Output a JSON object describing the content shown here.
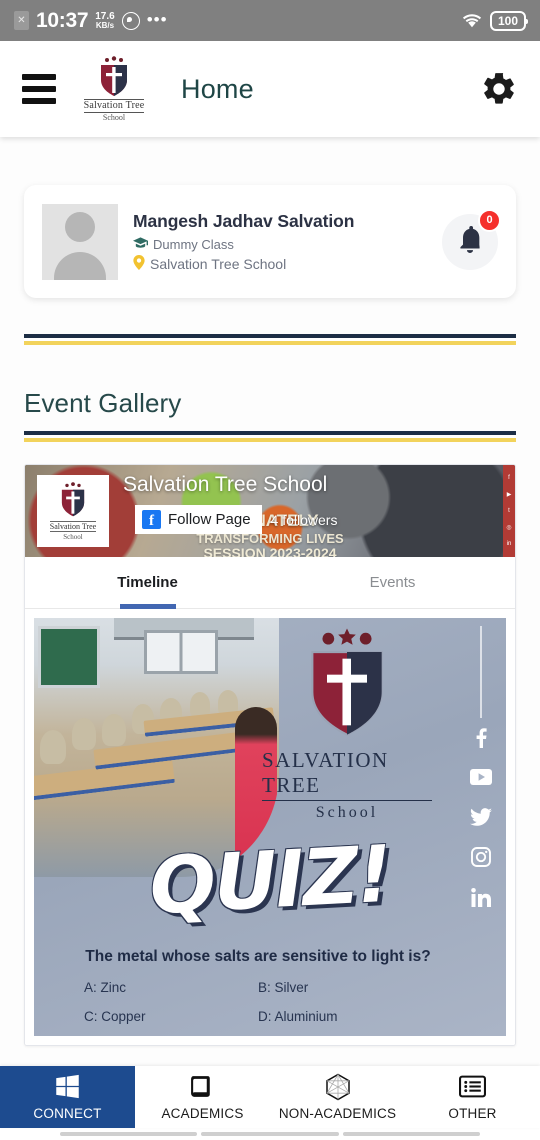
{
  "status_bar": {
    "sim_icon": "sim-card-icon",
    "time": "10:37",
    "net_speed_value": "17.6",
    "net_speed_unit": "KB/s",
    "whatsapp_icon": "whatsapp-icon",
    "more_icon": "more-dots-icon",
    "wifi_icon": "wifi-icon",
    "battery": "100"
  },
  "app_bar": {
    "menu_icon": "hamburger-menu-icon",
    "logo_name": "Salvation Tree",
    "logo_sub": "School",
    "title": "Home",
    "settings_icon": "gear-icon"
  },
  "profile": {
    "name": "Mangesh Jadhav Salvation",
    "class_icon": "graduation-cap-icon",
    "class": "Dummy Class",
    "location_icon": "location-pin-icon",
    "school": "Salvation Tree School",
    "bell_icon": "bell-icon",
    "notification_count": "0"
  },
  "section": {
    "title": "Event Gallery",
    "divider_navy": "#1d2e45",
    "divider_gold": "#f2d35c"
  },
  "facebook_embed": {
    "page_name": "Salvation Tree School",
    "page_logo_name": "Salvation Tree",
    "page_logo_sub": "School",
    "follow_label": "Follow Page",
    "follow_icon": "facebook-icon",
    "followers": "4 followers",
    "cover_line1": "...IONATELY",
    "cover_line2": "TRANSFORMING LIVES",
    "cover_line3": "SESSION 2023-2024",
    "tabs": [
      {
        "label": "Timeline",
        "active": true
      },
      {
        "label": "Events",
        "active": false
      }
    ],
    "post": {
      "logo_name": "SALVATION TREE",
      "logo_sub": "School",
      "headline": "QUIZ!",
      "question": "The metal whose salts are sensitive to light is?",
      "options": [
        "A: Zinc",
        "B: Silver",
        "C: Copper",
        "D: Aluminium"
      ],
      "socials": [
        "facebook-icon",
        "youtube-icon",
        "twitter-icon",
        "instagram-icon",
        "linkedin-icon"
      ]
    }
  },
  "bottom_nav": {
    "items": [
      {
        "label": "CONNECT",
        "icon": "windows-tiles-icon",
        "active": true
      },
      {
        "label": "ACADEMICS",
        "icon": "book-icon",
        "active": false
      },
      {
        "label": "NON-ACADEMICS",
        "icon": "hexagon-icon",
        "active": false
      },
      {
        "label": "OTHER",
        "icon": "list-icon",
        "active": false
      }
    ],
    "active_color": "#1d4b8f"
  }
}
